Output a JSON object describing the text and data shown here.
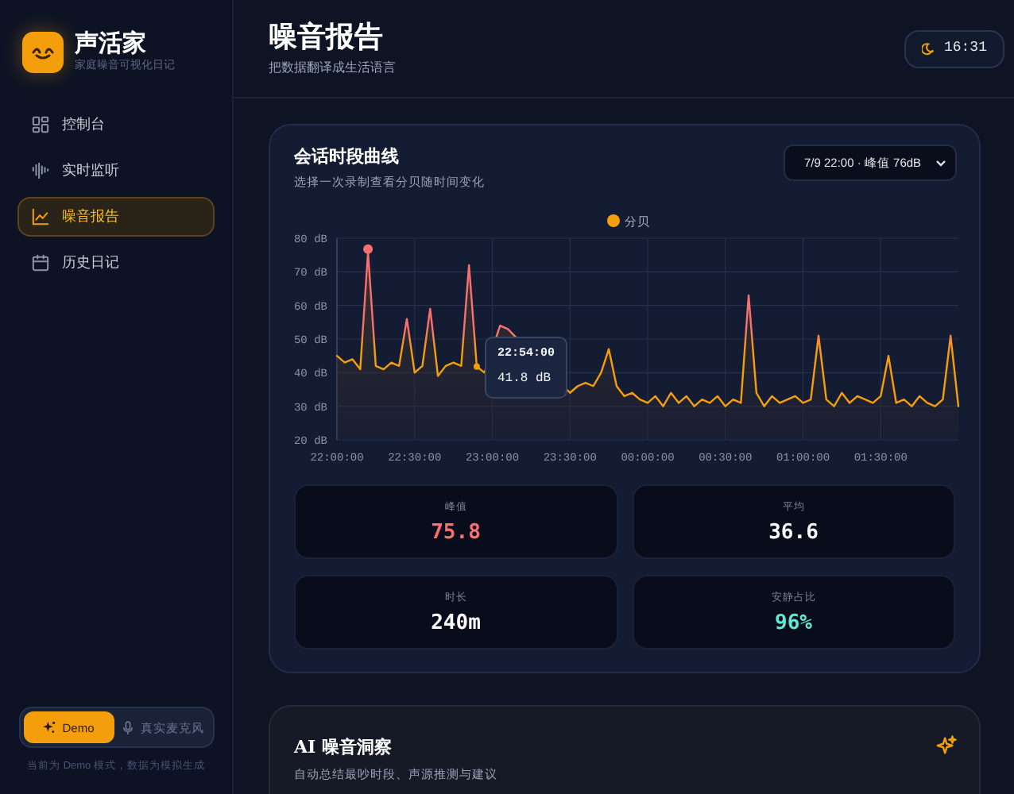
{
  "brand": {
    "name": "声活家",
    "tagline": "家庭噪音可视化日记"
  },
  "nav": [
    {
      "label": "控制台",
      "kind": "dashboard",
      "selected": false
    },
    {
      "label": "实时监听",
      "kind": "wave",
      "selected": false
    },
    {
      "label": "噪音报告",
      "kind": "report",
      "selected": true
    },
    {
      "label": "历史日记",
      "kind": "calendar",
      "selected": false
    }
  ],
  "mode_toggle": {
    "options": [
      {
        "label": "Demo",
        "kind": "demo",
        "selected": true
      },
      {
        "label": "真实麦克风",
        "kind": "mic",
        "selected": false
      }
    ],
    "note": "当前为 Demo 模式，数据为模拟生成"
  },
  "header": {
    "title": "噪音报告",
    "subtitle": "把数据翻译成生活语言",
    "clock": "16:31"
  },
  "session_card": {
    "title": "会话时段曲线",
    "subtitle": "选择一次录制查看分贝随时间变化",
    "select_value": "7/9 22:00 · 峰值 76dB",
    "chart_data": {
      "type": "area",
      "grid": true,
      "categories": [
        "22:00:00",
        null,
        null,
        null,
        null,
        null,
        null,
        null,
        null,
        null,
        "22:30:00",
        null,
        null,
        null,
        null,
        null,
        null,
        null,
        null,
        null,
        "23:00:00",
        null,
        null,
        null,
        null,
        null,
        null,
        null,
        null,
        null,
        "23:30:00",
        null,
        null,
        null,
        null,
        null,
        null,
        null,
        null,
        null,
        "00:00:00",
        null,
        null,
        null,
        null,
        null,
        null,
        null,
        null,
        null,
        "00:30:00",
        null,
        null,
        null,
        null,
        null,
        null,
        null,
        null,
        null,
        "01:00:00",
        null,
        null,
        null,
        null,
        null,
        null,
        null,
        null,
        null,
        "01:30:00",
        null,
        null,
        null,
        null,
        null,
        null,
        null,
        null,
        null,
        null
      ],
      "series": [
        {
          "name": "分贝",
          "color": "#f59e0b",
          "values": [
            45,
            43,
            44,
            41,
            75.8,
            42,
            41,
            43,
            42,
            56,
            40,
            42,
            59,
            39,
            42,
            43,
            42,
            72,
            41.8,
            40,
            null,
            54,
            53,
            null,
            null,
            null,
            null,
            null,
            null,
            null,
            34,
            36,
            37,
            36,
            40,
            47,
            36,
            33,
            34,
            32,
            31,
            33,
            30,
            34,
            31,
            33,
            30,
            32,
            31,
            33,
            30,
            32,
            31,
            63,
            34,
            30,
            33,
            31,
            32,
            33,
            31,
            32,
            51,
            32,
            30,
            34,
            31,
            33,
            32,
            31,
            33,
            45,
            31,
            32,
            30,
            33,
            31,
            30,
            32,
            51,
            30
          ]
        }
      ],
      "ylim": [
        20,
        80
      ],
      "yticks": [
        {
          "value": 20,
          "label": "20 dB"
        },
        {
          "value": 30,
          "label": "30 dB"
        },
        {
          "value": 40,
          "label": "40 dB"
        },
        {
          "value": 50,
          "label": "50 dB"
        },
        {
          "value": 60,
          "label": "60 dB"
        },
        {
          "value": 70,
          "label": "70 dB"
        },
        {
          "value": 80,
          "label": "80 dB"
        }
      ]
    },
    "tooltip": {
      "time": "22:54:00",
      "value": "41.8 dB"
    },
    "stats": [
      {
        "label": "峰值",
        "value": "75.8",
        "color": "#f87171"
      },
      {
        "label": "平均",
        "value": "36.6",
        "color": "#f8fafc"
      },
      {
        "label": "时长",
        "value": "240m",
        "color": "#f8fafc"
      },
      {
        "label": "安静占比",
        "value": "96%",
        "color": "#5eead4"
      }
    ]
  },
  "insight_card": {
    "title": "AI 噪音洞察",
    "subtitle": "自动总结最吵时段、声源推测与建议"
  }
}
